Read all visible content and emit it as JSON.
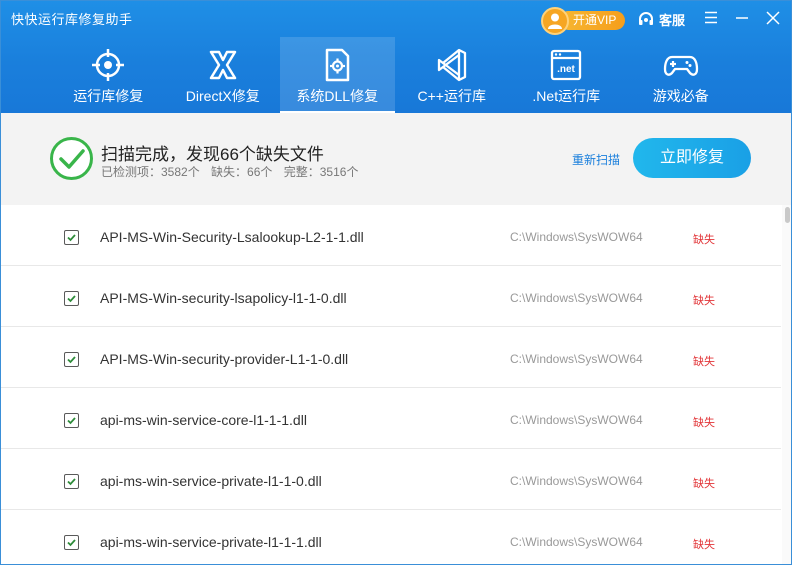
{
  "app": {
    "title": "快快运行库修复助手"
  },
  "header": {
    "vip_label": "开通VIP",
    "support_label": "客服"
  },
  "tabs": [
    {
      "label": "运行库修复",
      "icon": "target-icon",
      "active": false
    },
    {
      "label": "DirectX修复",
      "icon": "directx-icon",
      "active": false
    },
    {
      "label": "系统DLL修复",
      "icon": "dll-file-icon",
      "active": true
    },
    {
      "label": "C++运行库",
      "icon": "visual-studio-icon",
      "active": false
    },
    {
      "label": ".Net运行库",
      "icon": "dotnet-window-icon",
      "active": false
    },
    {
      "label": "游戏必备",
      "icon": "gamepad-icon",
      "active": false
    }
  ],
  "status": {
    "title": "扫描完成，发现66个缺失文件",
    "checked": "已检测项：3582个",
    "missing": "缺失：66个",
    "complete": "完整：3516个",
    "rescan_label": "重新扫描",
    "fix_label": "立即修复"
  },
  "files": [
    {
      "name": "API-MS-Win-Security-Lsalookup-L2-1-1.dll",
      "path": "C:\\Windows\\SysWOW64",
      "state": "缺失",
      "checked": true
    },
    {
      "name": "API-MS-Win-security-lsapolicy-l1-1-0.dll",
      "path": "C:\\Windows\\SysWOW64",
      "state": "缺失",
      "checked": true
    },
    {
      "name": "API-MS-Win-security-provider-L1-1-0.dll",
      "path": "C:\\Windows\\SysWOW64",
      "state": "缺失",
      "checked": true
    },
    {
      "name": "api-ms-win-service-core-l1-1-1.dll",
      "path": "C:\\Windows\\SysWOW64",
      "state": "缺失",
      "checked": true
    },
    {
      "name": "api-ms-win-service-private-l1-1-0.dll",
      "path": "C:\\Windows\\SysWOW64",
      "state": "缺失",
      "checked": true
    },
    {
      "name": "api-ms-win-service-private-l1-1-1.dll",
      "path": "C:\\Windows\\SysWOW64",
      "state": "缺失",
      "checked": true
    }
  ],
  "colors": {
    "header_blue": "#1a7fdc",
    "accent_cyan": "#21b7ec",
    "success_green": "#39b54a",
    "missing_red": "#e2373a",
    "vip_orange": "#f59e1b"
  }
}
